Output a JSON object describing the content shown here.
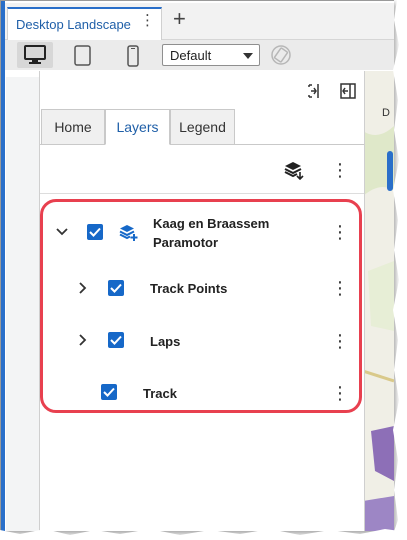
{
  "tabbar": {
    "device_tab_label": "Desktop Landscape",
    "more_icon": "⋮",
    "add_icon": "+"
  },
  "device_toolbar": {
    "select_value": "Default"
  },
  "panel": {
    "tabs": [
      {
        "label": "Home"
      },
      {
        "label": "Layers"
      },
      {
        "label": "Legend"
      }
    ],
    "active_tab": "Layers",
    "kebab": "⋮"
  },
  "layers": [
    {
      "name_line1": "Kaag en Braassem",
      "name_line2": "Paramotor",
      "checked": true,
      "expandable": true,
      "expanded": true
    },
    {
      "name": "Track Points",
      "checked": true,
      "expandable": true,
      "expanded": false
    },
    {
      "name": "Laps",
      "checked": true,
      "expandable": true,
      "expanded": false
    },
    {
      "name": "Track",
      "checked": true,
      "expandable": false
    }
  ],
  "map_edge_text": "D",
  "colors": {
    "accent": "#1668c8",
    "highlight": "#e8404f",
    "tab_active_text": "#1f5fa8"
  }
}
